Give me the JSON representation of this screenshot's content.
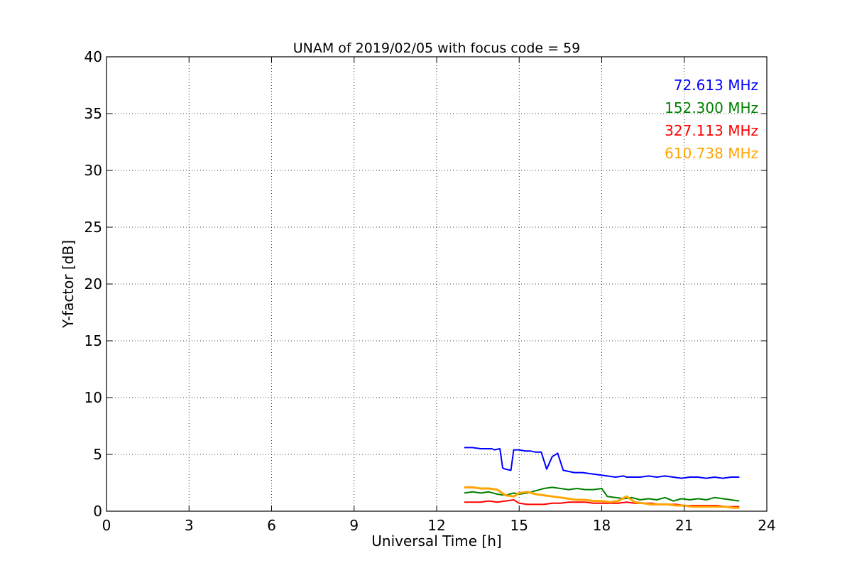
{
  "chart_data": {
    "type": "line",
    "title": "UNAM of 2019/02/05 with focus code = 59",
    "xlabel": "Universal Time [h]",
    "ylabel": "Y-factor [dB]",
    "xlim": [
      0,
      24
    ],
    "ylim": [
      0,
      40
    ],
    "xticks": [
      0,
      3,
      6,
      9,
      12,
      15,
      18,
      21,
      24
    ],
    "xtick_labels": [
      "0",
      "3",
      "6",
      "9",
      "12",
      "15",
      "18",
      "21",
      "24"
    ],
    "yticks": [
      0,
      5,
      10,
      15,
      20,
      25,
      30,
      35,
      40
    ],
    "ytick_labels": [
      "0",
      "5",
      "10",
      "15",
      "20",
      "25",
      "30",
      "35",
      "40"
    ],
    "grid": true,
    "legend_placement": "top-right",
    "series": [
      {
        "name": "72.613 MHz",
        "color": "#0000ff",
        "x": [
          13.0,
          13.3,
          13.6,
          13.9,
          14.0,
          14.1,
          14.3,
          14.4,
          14.5,
          14.7,
          14.8,
          15.0,
          15.2,
          15.4,
          15.6,
          15.8,
          16.0,
          16.2,
          16.4,
          16.6,
          16.8,
          17.0,
          17.3,
          17.6,
          17.9,
          18.2,
          18.5,
          18.8,
          18.9,
          19.1,
          19.4,
          19.7,
          20.0,
          20.3,
          20.6,
          20.9,
          21.2,
          21.5,
          21.8,
          22.1,
          22.4,
          22.7,
          23.0
        ],
        "y": [
          5.6,
          5.6,
          5.5,
          5.5,
          5.5,
          5.4,
          5.5,
          3.8,
          3.7,
          3.6,
          5.4,
          5.4,
          5.3,
          5.3,
          5.2,
          5.2,
          3.7,
          4.8,
          5.1,
          3.6,
          3.5,
          3.4,
          3.4,
          3.3,
          3.2,
          3.1,
          3.0,
          3.1,
          3.0,
          3.0,
          3.0,
          3.1,
          3.0,
          3.1,
          3.0,
          2.9,
          3.0,
          3.0,
          2.9,
          3.0,
          2.9,
          3.0,
          3.0
        ]
      },
      {
        "name": "152.300 MHz",
        "color": "#008000",
        "x": [
          13.0,
          13.3,
          13.6,
          13.9,
          14.2,
          14.5,
          14.8,
          15.0,
          15.3,
          15.6,
          15.9,
          16.2,
          16.5,
          16.8,
          17.1,
          17.4,
          17.7,
          18.0,
          18.2,
          18.5,
          18.8,
          19.1,
          19.4,
          19.7,
          20.0,
          20.3,
          20.6,
          20.9,
          21.2,
          21.5,
          21.8,
          22.1,
          22.4,
          22.7,
          23.0
        ],
        "y": [
          1.6,
          1.7,
          1.6,
          1.7,
          1.5,
          1.4,
          1.6,
          1.5,
          1.6,
          1.8,
          2.0,
          2.1,
          2.0,
          1.9,
          2.0,
          1.9,
          1.9,
          2.0,
          1.3,
          1.2,
          1.1,
          1.2,
          1.0,
          1.1,
          1.0,
          1.2,
          0.9,
          1.1,
          1.0,
          1.1,
          1.0,
          1.2,
          1.1,
          1.0,
          0.9
        ]
      },
      {
        "name": "327.113 MHz",
        "color": "#ff0000",
        "x": [
          13.0,
          13.3,
          13.6,
          13.9,
          14.2,
          14.5,
          14.8,
          15.0,
          15.3,
          15.6,
          15.9,
          16.2,
          16.5,
          16.8,
          17.1,
          17.4,
          17.7,
          18.0,
          18.3,
          18.6,
          18.9,
          19.2,
          19.5,
          19.8,
          20.1,
          20.4,
          20.7,
          21.0,
          21.3,
          21.6,
          21.9,
          22.2,
          22.5,
          22.8,
          23.0
        ],
        "y": [
          0.8,
          0.8,
          0.8,
          0.9,
          0.8,
          0.9,
          1.0,
          0.7,
          0.6,
          0.6,
          0.6,
          0.7,
          0.7,
          0.8,
          0.8,
          0.8,
          0.7,
          0.7,
          0.7,
          0.7,
          0.8,
          0.7,
          0.7,
          0.7,
          0.6,
          0.6,
          0.6,
          0.5,
          0.5,
          0.5,
          0.5,
          0.5,
          0.4,
          0.4,
          0.4
        ]
      },
      {
        "name": "610.738 MHz",
        "color": "#ffa500",
        "x": [
          13.0,
          13.3,
          13.6,
          13.9,
          14.2,
          14.5,
          14.8,
          15.0,
          15.3,
          15.6,
          15.9,
          16.2,
          16.5,
          16.8,
          17.1,
          17.4,
          17.7,
          18.0,
          18.3,
          18.6,
          18.9,
          19.2,
          19.5,
          19.8,
          20.1,
          20.4,
          20.7,
          21.0,
          21.3,
          21.6,
          21.9,
          22.2,
          22.5,
          22.8,
          23.0
        ],
        "y": [
          2.1,
          2.1,
          2.0,
          2.0,
          1.9,
          1.4,
          1.3,
          1.6,
          1.7,
          1.5,
          1.4,
          1.3,
          1.2,
          1.1,
          1.0,
          1.0,
          0.9,
          0.9,
          0.8,
          0.9,
          1.3,
          0.8,
          0.7,
          0.6,
          0.6,
          0.6,
          0.5,
          0.5,
          0.4,
          0.4,
          0.4,
          0.4,
          0.4,
          0.3,
          0.3
        ]
      }
    ]
  }
}
